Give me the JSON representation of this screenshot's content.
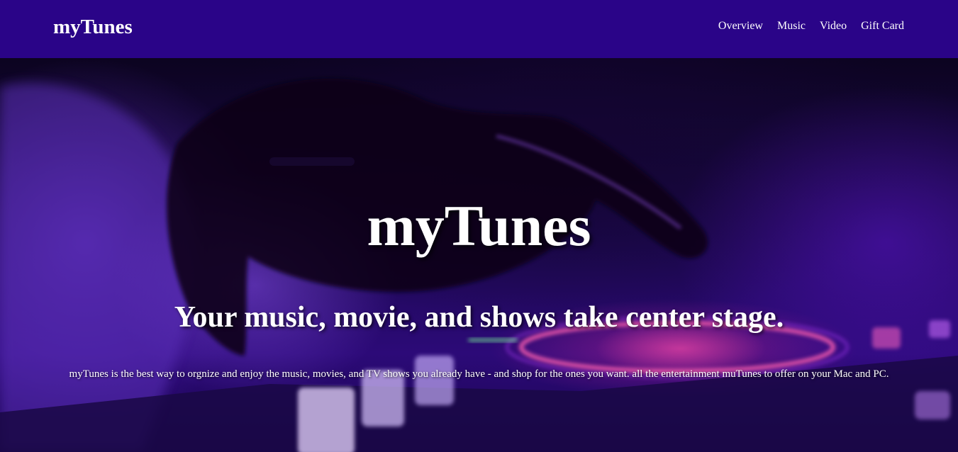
{
  "navbar": {
    "brand": "myTunes",
    "links": [
      "Overview",
      "Music",
      "Video",
      "Gift Card"
    ],
    "background": "#2a0488"
  },
  "hero": {
    "title": "myTunes",
    "subtitle": "Your music, movie, and shows take center stage.",
    "description": "myTunes is the best way to orgnize and enjoy the music, movies, and TV shows you already have - and shop for the ones you want. all the entertainment muTunes to offer on your Mac and PC.",
    "accent": "#ff4fa8"
  }
}
